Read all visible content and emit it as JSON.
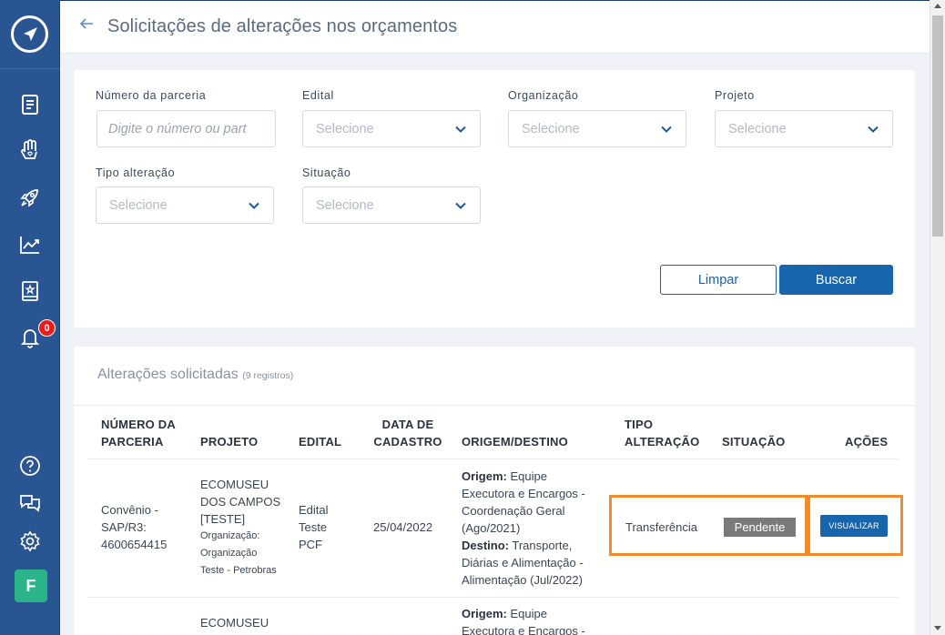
{
  "header": {
    "title": "Solicitações de alterações nos orçamentos"
  },
  "sidebar": {
    "icons": [
      "logo-icon",
      "document-icon",
      "hand-heart-icon",
      "rocket-icon",
      "chart-line-icon",
      "book-star-icon",
      "bell-icon",
      "help-icon",
      "chat-icon",
      "gear-icon"
    ],
    "notification_count": "0",
    "avatar_initial": "F"
  },
  "filters": {
    "partnership_number": {
      "label": "Número da parceria",
      "placeholder": "Digite o número ou part"
    },
    "edital": {
      "label": "Edital",
      "value": "Selecione"
    },
    "organizacao": {
      "label": "Organização",
      "value": "Selecione"
    },
    "projeto": {
      "label": "Projeto",
      "value": "Selecione"
    },
    "tipo_alteracao": {
      "label": "Tipo alteração",
      "value": "Selecione"
    },
    "situacao": {
      "label": "Situação",
      "value": "Selecione"
    },
    "clear_label": "Limpar",
    "search_label": "Buscar"
  },
  "table": {
    "title": "Alterações solicitadas",
    "count_text": "(9 registros)",
    "headers": {
      "numero_l1": "NÚMERO DA",
      "numero_l2": "PARCERIA",
      "projeto": "PROJETO",
      "edital": "EDITAL",
      "data_l1": "DATA DE",
      "data_l2": "CADASTRO",
      "origem": "ORIGEM/DESTINO",
      "tipo_l1": "TIPO",
      "tipo_l2": "ALTERAÇÃO",
      "situacao": "SITUAÇÃO",
      "acoes": "AÇÕES"
    },
    "rows": [
      {
        "numero_l1": "Convênio -",
        "numero_l2": "SAP/R3:",
        "numero_l3": "4600654415",
        "projeto_l1": "ECOMUSEU",
        "projeto_l2": "DOS CAMPOS",
        "projeto_l3": "[TESTE]",
        "org_l1": "Organização:",
        "org_l2": "Organização",
        "org_l3": "Teste - Petrobras",
        "edital_l1": "Edital",
        "edital_l2": "Teste",
        "edital_l3": "PCF",
        "data": "25/04/2022",
        "origem_label": "Origem:",
        "origem_l1": " Equipe",
        "origem_l2": "Executora e Encargos -",
        "origem_l3": "Coordenação Geral",
        "origem_l4": "(Ago/2021)",
        "destino_label": "Destino:",
        "destino_l1": " Transporte,",
        "destino_l2": "Diárias e Alimentação -",
        "destino_l3": "Alimentação (Jul/2022)",
        "tipo": "Transferência",
        "situacao": "Pendente",
        "acao": "VISUALIZAR"
      },
      {
        "projeto_l1": "ECOMUSEU",
        "origem_label": "Origem:",
        "origem_l1": " Equipe",
        "origem_l2": "Executora e Encargos -"
      }
    ]
  },
  "colors": {
    "sidebar": "#2a5593",
    "primary": "#1765ac",
    "highlight": "#f28c2b",
    "status_pending": "#7a7a7a"
  }
}
